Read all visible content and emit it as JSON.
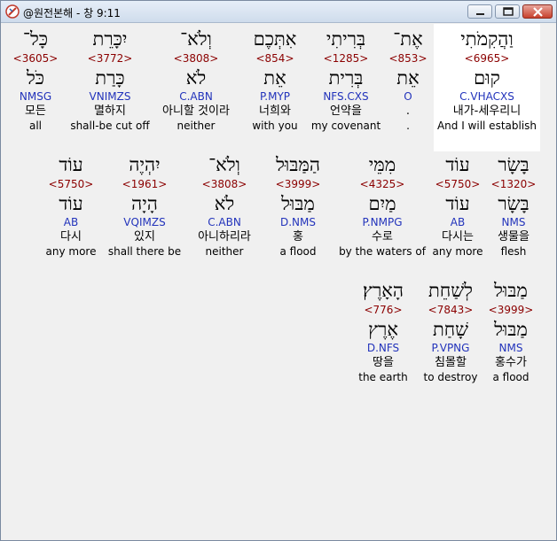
{
  "window": {
    "title": "@원전본해 - 창 9:11"
  },
  "words": [
    {
      "heb": "כָּל־",
      "strong": "<3605>",
      "lemma": "כֹּל",
      "morph": "NMSG",
      "kor": "모든",
      "eng": "all"
    },
    {
      "heb": "יִכָּרֵת",
      "strong": "<3772>",
      "lemma": "כָּרַת",
      "morph": "VNIMZS",
      "kor": "멸하지",
      "eng": "shall-be cut off"
    },
    {
      "heb": "וְלֹא־",
      "strong": "<3808>",
      "lemma": "לֹא",
      "morph": "C.ABN",
      "kor": "아니할 것이라",
      "eng": "neither"
    },
    {
      "heb": "אִתְּכֶם",
      "strong": "<854>",
      "lemma": "אֵת",
      "morph": "P.MYP",
      "kor": "너희와",
      "eng": "with you"
    },
    {
      "heb": "בְּרִיתִי",
      "strong": "<1285>",
      "lemma": "בְּרִית",
      "morph": "NFS.CXS",
      "kor": "언약을",
      "eng": "my covenant"
    },
    {
      "heb": "אֶת־",
      "strong": "<853>",
      "lemma": "אֵת",
      "morph": "O",
      "kor": ".",
      "eng": "."
    },
    {
      "heb": "וַהֲקִמֹתִי",
      "strong": "<6965>",
      "lemma": "קוּם",
      "morph": "C.VHACXS",
      "kor": "내가-세우리니",
      "eng": "And I will establish"
    },
    {
      "heb": "עוֹד",
      "strong": "<5750>",
      "lemma": "עוֹד",
      "morph": "AB",
      "kor": "다시",
      "eng": "any more"
    },
    {
      "heb": "יִהְיֶה",
      "strong": "<1961>",
      "lemma": "הָיָה",
      "morph": "VQIMZS",
      "kor": "있지",
      "eng": "shall there be"
    },
    {
      "heb": "וְלֹא־",
      "strong": "<3808>",
      "lemma": "לֹא",
      "morph": "C.ABN",
      "kor": "아니하리라",
      "eng": "neither"
    },
    {
      "heb": "הַמַּבּוּל",
      "strong": "<3999>",
      "lemma": "מַבּוּל",
      "morph": "D.NMS",
      "kor": "홍",
      "eng": "a flood"
    },
    {
      "heb": "מִמֵּי",
      "strong": "<4325>",
      "lemma": "מַיִם",
      "morph": "P.NMPG",
      "kor": "수로",
      "eng": "by the waters of"
    },
    {
      "heb": "עוֹד",
      "strong": "<5750>",
      "lemma": "עוֹד",
      "morph": "AB",
      "kor": "다시는",
      "eng": "any more"
    },
    {
      "heb": "בָּשָׂר",
      "strong": "<1320>",
      "lemma": "בָּשָׂר",
      "morph": "NMS",
      "kor": "생물을",
      "eng": "flesh"
    },
    {
      "heb": "הָאָרֶץ׃",
      "strong": "<776>",
      "lemma": "אֶרֶץ",
      "morph": "D.NFS",
      "kor": "땅을",
      "eng": "the earth"
    },
    {
      "heb": "לְשַׁחֵת",
      "strong": "<7843>",
      "lemma": "שָׁחַת",
      "morph": "P.VPNG",
      "kor": "침몰할",
      "eng": "to destroy"
    },
    {
      "heb": "מַבּוּל",
      "strong": "<3999>",
      "lemma": "מַבּוּל",
      "morph": "NMS",
      "kor": "홍수가",
      "eng": "a flood"
    }
  ]
}
